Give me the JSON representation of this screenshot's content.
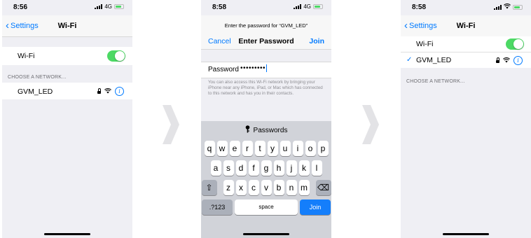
{
  "screen1": {
    "time": "8:56",
    "network_type": "4G",
    "back_label": "Settings",
    "title": "Wi-Fi",
    "wifi_label": "Wi-Fi",
    "section_header": "CHOOSE A NETWORK...",
    "network_name": "GVM_LED",
    "info_glyph": "i"
  },
  "screen2": {
    "time": "8:58",
    "network_type": "4G",
    "prompt": "Enter the password for “GVM_LED”",
    "cancel_label": "Cancel",
    "title": "Enter Password",
    "join_label": "Join",
    "password_label": "Password",
    "password_dots": "•••••••••",
    "hint": "You can also access this Wi-Fi network by bringing your iPhone near any iPhone, iPad, or Mac which has connected to this network and has you in their contacts.",
    "keyboard": {
      "passwords_label": "Passwords",
      "row1": [
        "q",
        "w",
        "e",
        "r",
        "t",
        "y",
        "u",
        "i",
        "o",
        "p"
      ],
      "row2": [
        "a",
        "s",
        "d",
        "f",
        "g",
        "h",
        "j",
        "k",
        "l"
      ],
      "row3": [
        "z",
        "x",
        "c",
        "v",
        "b",
        "n",
        "m"
      ],
      "shift_glyph": "⇧",
      "delete_glyph": "⌫",
      "numbers_label": ".?123",
      "space_label": "space",
      "join_label": "Join"
    }
  },
  "screen3": {
    "time": "8:58",
    "back_label": "Settings",
    "title": "Wi-Fi",
    "wifi_label": "Wi-Fi",
    "connected_network": "GVM_LED",
    "check_glyph": "✓",
    "section_header": "CHOOSE A NETWORK...",
    "info_glyph": "i"
  },
  "colors": {
    "accent": "#007aff",
    "toggle_on": "#4cd964",
    "background": "#efeff4",
    "keyboard": "#d1d3d9",
    "join_key": "#147efb"
  },
  "icons": [
    "signal-bars-icon",
    "battery-icon",
    "chevron-left-icon",
    "lock-icon",
    "wifi-icon",
    "info-icon",
    "key-icon",
    "shift-icon",
    "delete-icon",
    "checkmark-icon",
    "chevron-right-arrow-icon"
  ]
}
